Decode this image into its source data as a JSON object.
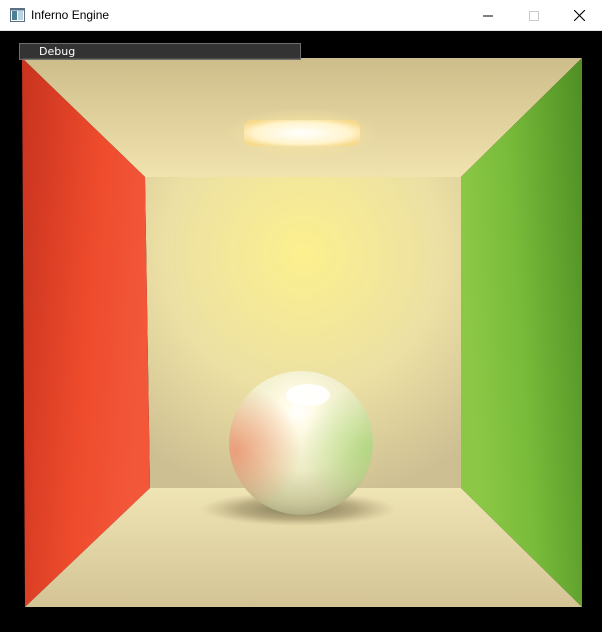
{
  "window": {
    "title": "Inferno Engine",
    "icon": "app-window-icon",
    "controls": [
      "minimize-icon",
      "maximize-icon",
      "close-icon"
    ]
  },
  "debug_panel": {
    "label": "Debug",
    "collapsed": true
  },
  "scene": {
    "description_type": "rendered-cornell-box",
    "colors": {
      "left_wall": "#e2432a",
      "right_wall": "#6fb33a",
      "back_wall": "#f2e39a",
      "floor": "#e8dcaa",
      "ceiling": "#e9d7a4",
      "light": "#fff7d8",
      "sphere": "#f3efc9"
    }
  }
}
